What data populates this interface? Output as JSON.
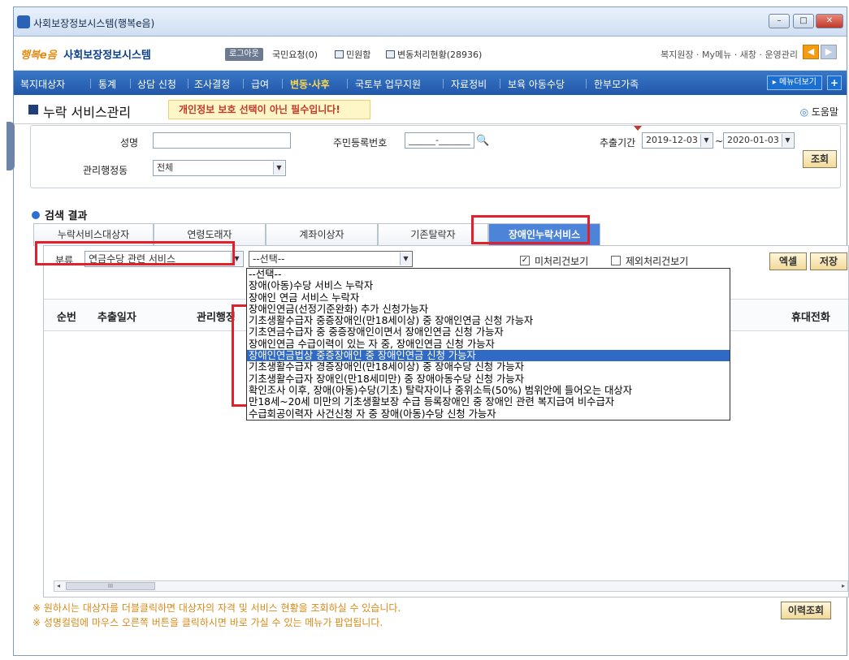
{
  "window": {
    "title": "사회보장정보시스템(행복e음)",
    "controls": [
      "–",
      "□",
      "✕"
    ]
  },
  "header": {
    "brand": "행복e음",
    "system_name": "사회보장정보시스템",
    "logout": "로그아웃",
    "national_requests": "국민요청(0)",
    "civil_complaint": "민원함",
    "change_status": "변동처리현황(28936)",
    "right_links": "복지원장 · My메뉴 · 새창 · 운영관리"
  },
  "nav": {
    "items": [
      "복지대상자",
      "통계",
      "상담 신청",
      "조사결정",
      "급여",
      "변동·사후",
      "국토부 업무지원",
      "자료정비",
      "보육 아동수당",
      "한부모가족"
    ],
    "menu_toggle": "▸ 메뉴더보기",
    "plus": "+"
  },
  "page": {
    "title": "누락 서비스관리",
    "banner": "개인정보 보호 선택이 아닌 필수입니다!",
    "help": "도움말"
  },
  "search": {
    "name_label": "성명",
    "name_value": "",
    "rrn_label": "주민등록번호",
    "rrn_value": "______-_______",
    "period_label": "추출기간",
    "period_from": "2019-12-03",
    "period_sep": "~",
    "period_to": "2020-01-03",
    "admin_label": "관리행정동",
    "admin_value": "전체",
    "query_button": "조회"
  },
  "results": {
    "title": "검색 결과",
    "tabs": [
      "누락서비스대상자",
      "연령도래자",
      "계좌이상자",
      "기존탈락자",
      "장애인누락서비스"
    ],
    "active_tab": 4,
    "category_label": "분류",
    "category_value": "연금수당 관련 서비스",
    "sub_select_value": "--선택--",
    "unprocessed_label": "미처리건보기",
    "unprocessed_checked": "✓",
    "excluded_label": "제외처리건보기",
    "excel_button": "엑셀",
    "save_button": "저장",
    "columns": [
      "순번",
      "추출일자",
      "관리행정",
      "휴대전화"
    ],
    "history_button": "이력조회",
    "scroll_thumb": "III",
    "scroll_left": "◂",
    "scroll_right": "▸"
  },
  "dropdown": {
    "options": [
      "--선택--",
      "장애(아동)수당 서비스 누락자",
      "장애인 연금 서비스 누락자",
      "장애인연금(선정기준완화) 추가 신청가능자",
      "기초생활수급자 중증장애인(만18세이상) 중 장애인연금 신청 가능자",
      "기초연금수급자 중 중증장애인이면서 장애인연금 신청 가능자",
      "장애인연금 수급이력이 있는 자 중, 장애인연금 신청 가능자",
      "장애인연금법상 중증장애인 중 장애인연금 신청 가능자",
      "기초생활수급자 경증장애인(만18세이상) 중 장애수당 신청 가능자",
      "기초생활수급자 장애인(만18세미만) 중 장애아동수당 신청 가능자",
      "확인조사 이후, 장애(아동)수당(기초) 탈락자이나 중위소득(50%) 범위안에 들어오는 대상자",
      "만18세~20세 미만의 기초생활보장 수급 등록장애인 중 장애인 관련 복지급여 비수급자",
      "수급회공이력자 사건신청 자 중 장애(아동)수당 신청 가능자"
    ],
    "selected_index": 7
  },
  "notes": [
    "※ 원하시는 대상자를 더블클릭하면 대상자의 자격 및 서비스 현황을 조회하실 수 있습니다.",
    "※ 성명컬럼에 마우스 오른쪽 버튼을 클릭하시면 바로 가실 수 있는 메뉴가 팝업됩니다."
  ],
  "colors": {
    "highlight": "#e2202a",
    "nav": "#2c66b8",
    "selected": "#316ac5",
    "note": "#d98a1a"
  }
}
